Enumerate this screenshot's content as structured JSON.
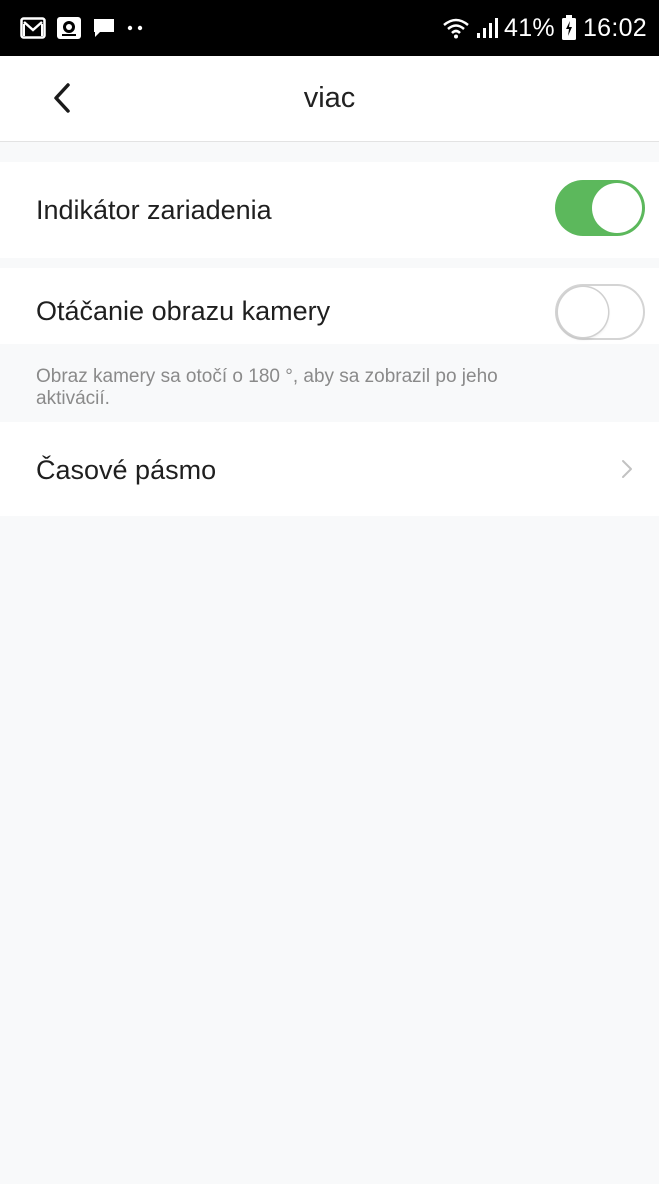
{
  "status_bar": {
    "left_icons": [
      "gmail-icon",
      "camera-app-icon",
      "message-icon",
      "more-dots-icon"
    ],
    "battery_percent": "41%",
    "time": "16:02"
  },
  "header": {
    "title": "viac"
  },
  "settings": {
    "device_indicator": {
      "label": "Indikátor zariadenia",
      "enabled": true
    },
    "image_rotation": {
      "label": "Otáčanie obrazu kamery",
      "enabled": false,
      "description": "Obraz kamery sa otočí o 180 °, aby sa zobrazil po jeho aktivácií."
    },
    "time_zone": {
      "label": "Časové pásmo"
    }
  },
  "colors": {
    "toggle_on": "#5cb85c",
    "page_background": "#f8f9fa"
  }
}
